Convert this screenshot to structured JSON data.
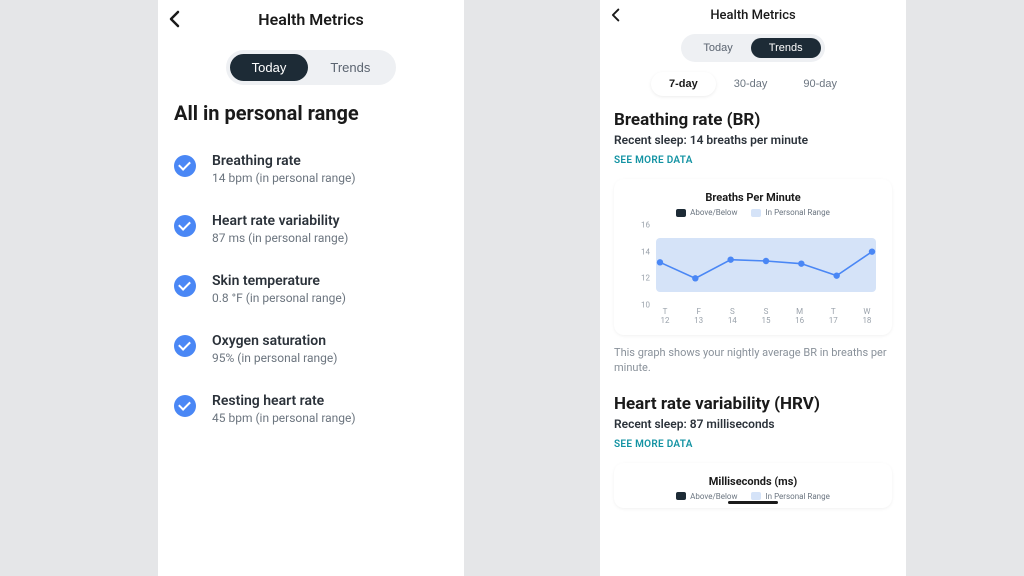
{
  "left": {
    "header_title": "Health Metrics",
    "tabs": {
      "today": "Today",
      "trends": "Trends",
      "active": "today"
    },
    "headline": "All in personal range",
    "metrics": [
      {
        "name": "Breathing rate",
        "value": "14 bpm (in personal range)"
      },
      {
        "name": "Heart rate variability",
        "value": "87 ms (in personal range)"
      },
      {
        "name": "Skin temperature",
        "value": "0.8 °F (in personal range)"
      },
      {
        "name": "Oxygen saturation",
        "value": "95% (in personal range)"
      },
      {
        "name": "Resting heart rate",
        "value": "45 bpm (in personal range)"
      }
    ]
  },
  "right": {
    "header_title": "Health Metrics",
    "tabs": {
      "today": "Today",
      "trends": "Trends",
      "active": "trends"
    },
    "range_tabs": {
      "d7": "7-day",
      "d30": "30-day",
      "d90": "90-day",
      "active": "d7"
    },
    "section1": {
      "title": "Breathing rate (BR)",
      "subtitle": "Recent sleep: 14 breaths per minute",
      "see_more": "SEE MORE DATA",
      "card_title": "Breaths Per Minute",
      "legend_above": "Above/Below",
      "legend_in": "In Personal Range",
      "caption": "This graph shows your nightly average BR in breaths per minute."
    },
    "section2": {
      "title": "Heart rate variability (HRV)",
      "subtitle": "Recent sleep: 87 milliseconds",
      "see_more": "SEE MORE DATA",
      "card_title": "Milliseconds (ms)",
      "legend_above": "Above/Below",
      "legend_in": "In Personal Range"
    }
  },
  "chart_data": {
    "type": "line",
    "title": "Breaths Per Minute",
    "ylabel": "",
    "ylim": [
      10,
      16
    ],
    "legend": [
      "Above/Below",
      "In Personal Range"
    ],
    "band": {
      "low": 11,
      "high": 15
    },
    "categories_day": [
      "T",
      "F",
      "S",
      "S",
      "M",
      "T",
      "W"
    ],
    "categories_date": [
      "12",
      "13",
      "14",
      "15",
      "16",
      "17",
      "18"
    ],
    "values": [
      13.2,
      12.0,
      13.4,
      13.3,
      13.1,
      12.2,
      14.0
    ]
  }
}
